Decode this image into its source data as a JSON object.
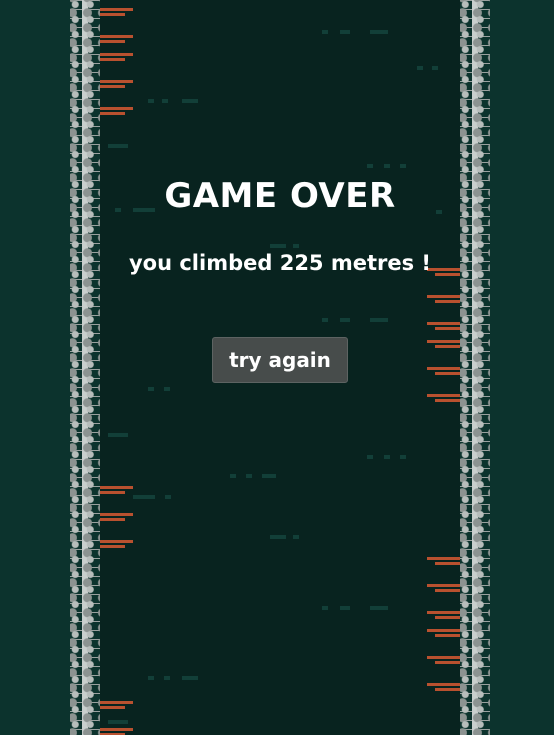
{
  "game_over": {
    "title": "GAME OVER",
    "score_message": "you climbed 225 metres !",
    "retry_label": "try again"
  },
  "colors": {
    "background": "#0c332d",
    "shaft": "#08231f",
    "wall_stone": "#b7bdbb",
    "ledge": "#b9512f",
    "button_bg": "#474c4b",
    "text": "#ffffff"
  },
  "icons": {
    "wall_texture": "stone-wall-icon",
    "ledge": "ledge-icon"
  }
}
